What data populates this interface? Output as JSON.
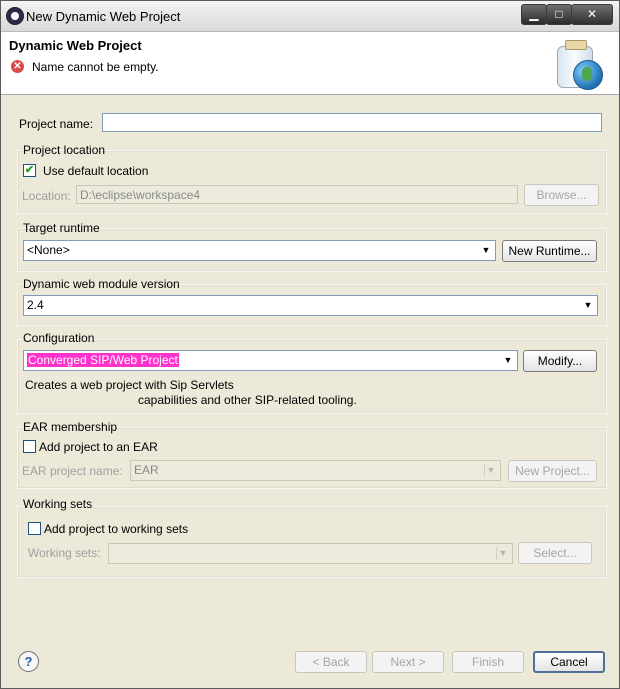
{
  "window": {
    "title": "New Dynamic Web Project",
    "controls": {
      "minimize": "▁",
      "maximize": "□",
      "close": "✕"
    }
  },
  "header": {
    "title": "Dynamic Web Project",
    "error_message": "Name cannot be empty.",
    "error_icon": "error-icon"
  },
  "project_name": {
    "label": "Project name:",
    "value": ""
  },
  "project_location": {
    "title": "Project location",
    "use_default": {
      "label": "Use default location",
      "checked": true
    },
    "location_label": "Location:",
    "location_value": "D:\\eclipse\\workspace4",
    "browse_button": "Browse..."
  },
  "target_runtime": {
    "title": "Target runtime",
    "selected": "<None>",
    "new_runtime_button": "New Runtime..."
  },
  "web_module_version": {
    "title": "Dynamic web module version",
    "selected": "2.4"
  },
  "configuration": {
    "title": "Configuration",
    "selected": "Converged SIP/Web Project",
    "modify_button": "Modify...",
    "description_line1": "Creates a web project with Sip Servlets",
    "description_line2": "capabilities and other SIP-related tooling."
  },
  "ear_membership": {
    "title": "EAR membership",
    "add_to_ear": {
      "label": "Add project to an EAR",
      "checked": false
    },
    "ear_name_label": "EAR project name:",
    "ear_name_value": "EAR",
    "new_project_button": "New Project..."
  },
  "working_sets": {
    "title": "Working sets",
    "add_to_sets": {
      "label": "Add project to working sets",
      "checked": false
    },
    "sets_label": "Working sets:",
    "sets_value": "",
    "select_button": "Select..."
  },
  "footer": {
    "help_icon": "?",
    "back_button": "< Back",
    "next_button": "Next >",
    "finish_button": "Finish",
    "cancel_button": "Cancel"
  }
}
